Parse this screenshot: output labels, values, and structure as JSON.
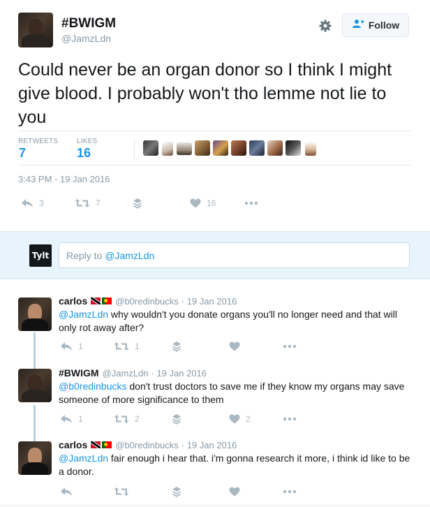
{
  "tweet": {
    "author_name": "#BWIGM",
    "author_handle": "@JamzLdn",
    "follow_label": "Follow",
    "text": "Could never be an organ donor so I think I might give blood. I probably won't tho lemme not lie to you",
    "stats": {
      "retweets_label": "RETWEETS",
      "retweets": "7",
      "likes_label": "LIKES",
      "likes": "16"
    },
    "timestamp": "3:43 PM - 19 Jan 2016",
    "actions": {
      "reply_count": "3",
      "retweet_count": "7",
      "like_count": "16"
    }
  },
  "reply_box": {
    "logo": "Tylt",
    "placeholder_prefix": "Reply to ",
    "placeholder_handle": "@JamzLdn"
  },
  "replies": [
    {
      "name": "carlos",
      "handle": "@b0redinbucks",
      "date": "· 19 Jan 2016",
      "mention": "@JamzLdn",
      "text": " why wouldn't you donate organs you'll no longer need and that will only rot away after?",
      "reply_count": "1",
      "retweet_count": "1",
      "like_count": ""
    },
    {
      "name": "#BWIGM",
      "handle": "@JamzLdn",
      "date": "· 19 Jan 2016",
      "mention": "@b0redinbucks",
      "text": " don't trust doctors to save me if they know my organs may save someone of more significance to them",
      "reply_count": "1",
      "retweet_count": "2",
      "like_count": "2"
    },
    {
      "name": "carlos",
      "handle": "@b0redinbucks",
      "date": "· 19 Jan 2016",
      "mention": "@JamzLdn",
      "text": " fair enough i hear that. i'm gonna research it more, i think id like to be a donor.",
      "reply_count": "",
      "retweet_count": "",
      "like_count": ""
    }
  ],
  "colors": {
    "link": "#1b95e0",
    "muted": "#8899a6",
    "icon": "#aab8c2",
    "divider": "#e1e8ed"
  },
  "icons": [
    "gear-icon",
    "follow-person-icon",
    "reply-icon",
    "retweet-icon",
    "stack-icon",
    "heart-icon",
    "more-icon"
  ]
}
